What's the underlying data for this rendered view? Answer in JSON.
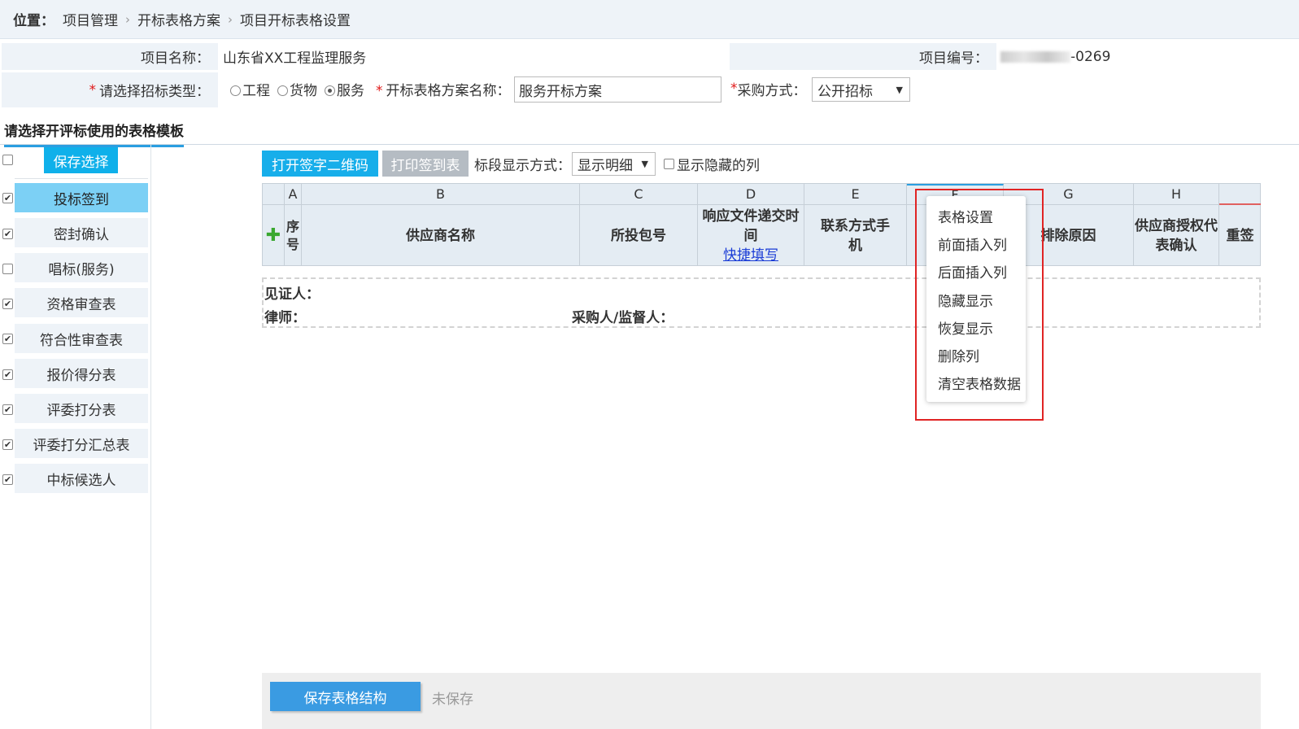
{
  "breadcrumb": {
    "label": "位置：",
    "items": [
      "项目管理",
      "开标表格方案",
      "项目开标表格设置"
    ]
  },
  "project": {
    "name_label": "项目名称：",
    "name_value": "山东省XX工程监理服务",
    "code_label": "项目编号：",
    "code_value": "-0269",
    "type_label": "请选择招标类型：",
    "type_options": [
      "工程",
      "货物",
      "服务"
    ],
    "type_selected": "服务",
    "scheme_label": "开标表格方案名称：",
    "scheme_value": "服务开标方案",
    "method_label": "采购方式：",
    "method_value": "公开招标"
  },
  "section_title": "请选择开评标使用的表格模板",
  "sidebar": {
    "save_button": "保存选择",
    "items": [
      {
        "label": "投标签到",
        "checked": true,
        "active": true
      },
      {
        "label": "密封确认",
        "checked": true
      },
      {
        "label": "唱标(服务)",
        "checked": false
      },
      {
        "label": "资格审查表",
        "checked": true
      },
      {
        "label": "符合性审查表",
        "checked": true
      },
      {
        "label": "报价得分表",
        "checked": true
      },
      {
        "label": "评委打分表",
        "checked": true
      },
      {
        "label": "评委打分汇总表",
        "checked": true
      },
      {
        "label": "中标候选人",
        "checked": true
      }
    ]
  },
  "toolbar": {
    "qr_button": "打开签字二维码",
    "print_button": "打印签到表",
    "segment_label": "标段显示方式：",
    "segment_value": "显示明细",
    "hidden_cols_label": "显示隐藏的列"
  },
  "table": {
    "col_letters": [
      "A",
      "B",
      "C",
      "D",
      "E",
      "F",
      "G",
      "H"
    ],
    "headers": {
      "seq": "序号",
      "supplier": "供应商名称",
      "package": "所投包号",
      "submit_time": "响应文件递交时间",
      "quick_fill": "快捷填写",
      "contact": "联系方式手机",
      "exclude": "排除原因",
      "auth": "供应商授权代表确认",
      "resign": "重签"
    }
  },
  "signatures": {
    "witness": "见证人：",
    "lawyer": "律师：",
    "purchaser": "采购人/监督人："
  },
  "context_menu": [
    "表格设置",
    "前面插入列",
    "后面插入列",
    "隐藏显示",
    "恢复显示",
    "删除列",
    "清空表格数据"
  ],
  "footer": {
    "save_button": "保存表格结构",
    "status": "未保存"
  },
  "colors": {
    "accent": "#17aeea",
    "highlight": "#e02424"
  }
}
